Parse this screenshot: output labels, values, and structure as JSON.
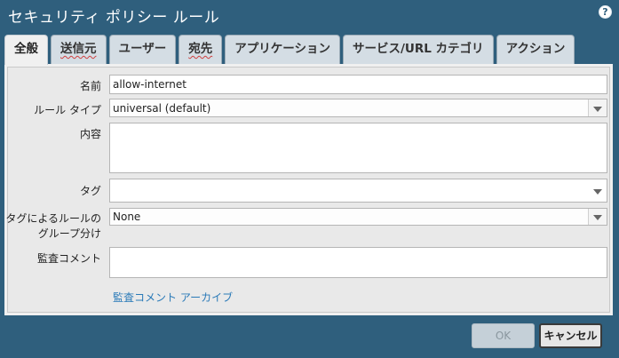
{
  "window": {
    "title": "セキュリティ ポリシー ルール",
    "help_glyph": "?"
  },
  "tabs": [
    {
      "label": "全般",
      "active": true
    },
    {
      "label": "送信元",
      "active": false
    },
    {
      "label": "ユーザー",
      "active": false
    },
    {
      "label": "宛先",
      "active": false
    },
    {
      "label": "アプリケーション",
      "active": false
    },
    {
      "label": "サービス/URL カテゴリ",
      "active": false
    },
    {
      "label": "アクション",
      "active": false
    }
  ],
  "form": {
    "name": {
      "label": "名前",
      "value": "allow-internet"
    },
    "rule_type": {
      "label": "ルール タイプ",
      "value": "universal (default)"
    },
    "description": {
      "label": "内容",
      "value": ""
    },
    "tags": {
      "label": "タグ",
      "value": ""
    },
    "group_by_tag": {
      "label_line1": "タグによるルールの",
      "label_line2": "グループ分け",
      "value": "None"
    },
    "audit_comment": {
      "label": "監査コメント",
      "value": ""
    },
    "audit_archive_link": "監査コメント アーカイブ"
  },
  "buttons": {
    "ok": "OK",
    "cancel": "キャンセル"
  },
  "colors": {
    "titlebar_bg": "#2f5f7d",
    "link": "#2a7ab8"
  }
}
